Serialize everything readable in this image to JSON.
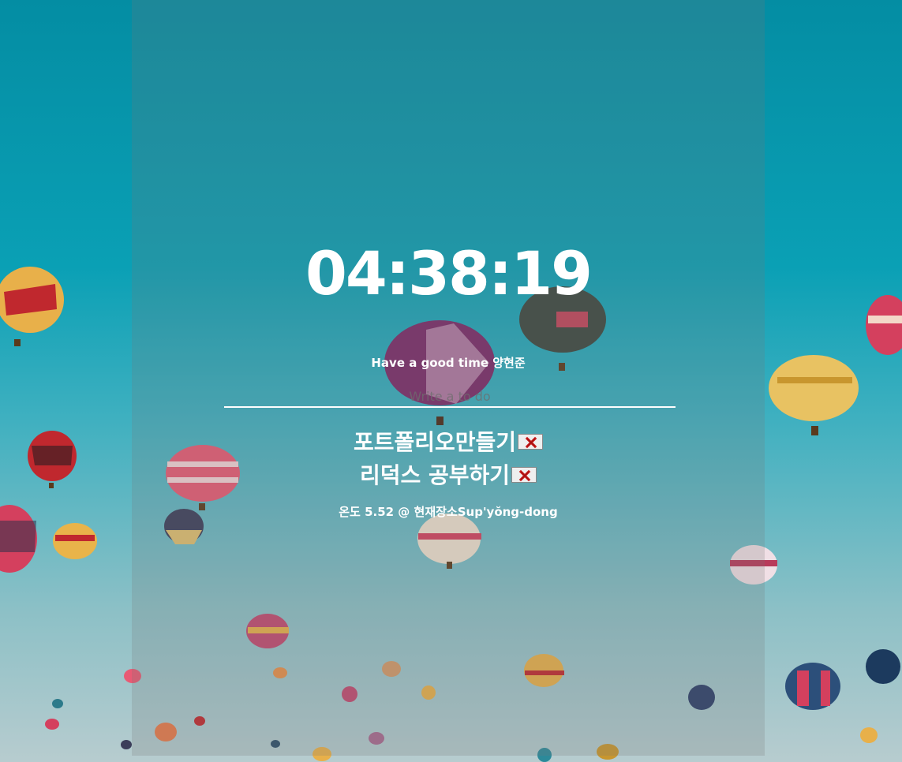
{
  "clock": {
    "time": "04:38:19"
  },
  "greeting": {
    "text": "Have a good time 양현준"
  },
  "todo": {
    "placeholder": "Write a to do",
    "items": [
      {
        "text": "포트폴리오만들기",
        "delete_icon": "red-x-icon"
      },
      {
        "text": "리덕스 공부하기",
        "delete_icon": "red-x-icon"
      }
    ]
  },
  "weather": {
    "text": "온도 5.52 @ 현재장소Sup'yŏng-dong"
  },
  "colors": {
    "sky_top": "#048da3",
    "sky_bottom": "#b7cccf",
    "text": "#ffffff",
    "delete_x": "#cc1a1a"
  }
}
